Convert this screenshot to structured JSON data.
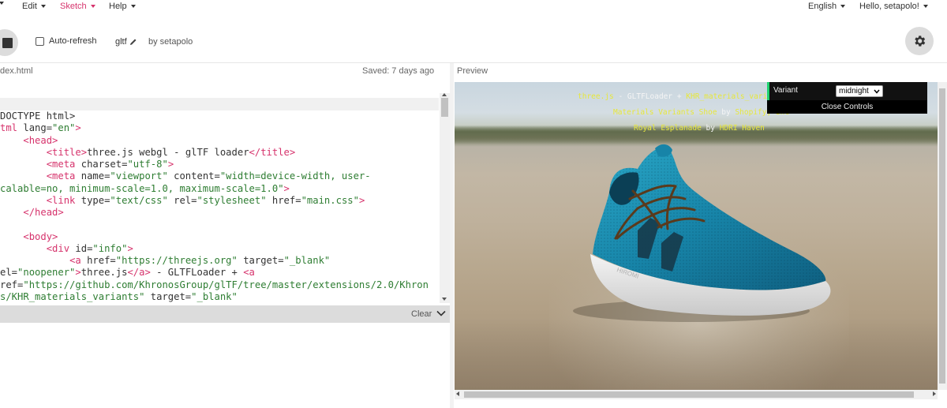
{
  "nav": {
    "menus": [
      {
        "label": "Edit"
      },
      {
        "label": "Sketch"
      },
      {
        "label": "Help"
      }
    ],
    "language": "English",
    "greeting": "Hello, setapolo!"
  },
  "toolbar": {
    "auto_refresh_label": "Auto-refresh",
    "auto_refresh_checked": false,
    "sketch_name": "gltf",
    "byline": "by setapolo"
  },
  "editor": {
    "file_name": "dex.html",
    "saved_status": "Saved: 7 days ago",
    "lines": [
      [
        {
          "t": "txt",
          "v": "DOCTYPE html>"
        }
      ],
      [
        {
          "t": "tag",
          "v": "tml "
        },
        {
          "t": "attr",
          "v": "lang="
        },
        {
          "t": "str",
          "v": "\"en\""
        },
        {
          "t": "tag",
          "v": ">"
        }
      ],
      [
        {
          "t": "txt",
          "v": "    "
        },
        {
          "t": "tag",
          "v": "<head>"
        }
      ],
      [
        {
          "t": "txt",
          "v": "        "
        },
        {
          "t": "tag",
          "v": "<title>"
        },
        {
          "t": "txt",
          "v": "three.js webgl - glTF loader"
        },
        {
          "t": "tag",
          "v": "</title>"
        }
      ],
      [
        {
          "t": "txt",
          "v": "        "
        },
        {
          "t": "tag",
          "v": "<meta "
        },
        {
          "t": "attr",
          "v": "charset="
        },
        {
          "t": "str",
          "v": "\"utf-8\""
        },
        {
          "t": "tag",
          "v": ">"
        }
      ],
      [
        {
          "t": "txt",
          "v": "        "
        },
        {
          "t": "tag",
          "v": "<meta "
        },
        {
          "t": "attr",
          "v": "name="
        },
        {
          "t": "str",
          "v": "\"viewport\""
        },
        {
          "t": "attr",
          "v": " content="
        },
        {
          "t": "str",
          "v": "\"width=device-width, user-"
        }
      ],
      [
        {
          "t": "str",
          "v": "calable=no, minimum-scale=1.0, maximum-scale=1.0\""
        },
        {
          "t": "tag",
          "v": ">"
        }
      ],
      [
        {
          "t": "txt",
          "v": "        "
        },
        {
          "t": "tag",
          "v": "<link "
        },
        {
          "t": "attr",
          "v": "type="
        },
        {
          "t": "str",
          "v": "\"text/css\""
        },
        {
          "t": "attr",
          "v": " rel="
        },
        {
          "t": "str",
          "v": "\"stylesheet\""
        },
        {
          "t": "attr",
          "v": " href="
        },
        {
          "t": "str",
          "v": "\"main.css\""
        },
        {
          "t": "tag",
          "v": ">"
        }
      ],
      [
        {
          "t": "txt",
          "v": "    "
        },
        {
          "t": "tag",
          "v": "</head>"
        }
      ],
      [
        {
          "t": "txt",
          "v": ""
        }
      ],
      [
        {
          "t": "txt",
          "v": "    "
        },
        {
          "t": "tag",
          "v": "<body>"
        }
      ],
      [
        {
          "t": "txt",
          "v": "        "
        },
        {
          "t": "tag",
          "v": "<div "
        },
        {
          "t": "attr",
          "v": "id="
        },
        {
          "t": "str",
          "v": "\"info\""
        },
        {
          "t": "tag",
          "v": ">"
        }
      ],
      [
        {
          "t": "txt",
          "v": "            "
        },
        {
          "t": "tag",
          "v": "<a "
        },
        {
          "t": "attr",
          "v": "href="
        },
        {
          "t": "str",
          "v": "\"https://threejs.org\""
        },
        {
          "t": "attr",
          "v": " target="
        },
        {
          "t": "str",
          "v": "\"_blank\""
        }
      ],
      [
        {
          "t": "attr",
          "v": "el="
        },
        {
          "t": "str",
          "v": "\"noopener\""
        },
        {
          "t": "tag",
          "v": ">"
        },
        {
          "t": "txt",
          "v": "three.js"
        },
        {
          "t": "tag",
          "v": "</a>"
        },
        {
          "t": "txt",
          "v": " - GLTFLoader + "
        },
        {
          "t": "tag",
          "v": "<a"
        }
      ],
      [
        {
          "t": "attr",
          "v": "ref="
        },
        {
          "t": "str",
          "v": "\"https://github.com/KhronosGroup/glTF/tree/master/extensions/2.0/Khron"
        }
      ],
      [
        {
          "t": "str",
          "v": "s/KHR_materials_variants\""
        },
        {
          "t": "attr",
          "v": " target="
        },
        {
          "t": "str",
          "v": "\"_blank\""
        }
      ]
    ]
  },
  "console": {
    "clear_label": "Clear"
  },
  "preview": {
    "label": "Preview",
    "info": {
      "line1_link1": "three.js",
      "line1_sep": " - GLTFLoader + ",
      "line1_link2": "KHR_materials_variants",
      "line2_link1": "Materials Variants Shoe",
      "line2_by": " by ",
      "line2_link2": "Shopify, Inc",
      "line3_link1": "Royal Esplanade",
      "line3_by": " by ",
      "line3_link2": "HDRI Haven"
    },
    "gui": {
      "variant_label": "Variant",
      "variant_value": "midnight",
      "close_label": "Close Controls"
    }
  },
  "colors": {
    "accent": "#d6336c",
    "info_yellow": "#e7e73c",
    "shoe_blue": "#1b8bb0",
    "sole": "#e8e8e8",
    "laces": "#5a3a1c"
  }
}
